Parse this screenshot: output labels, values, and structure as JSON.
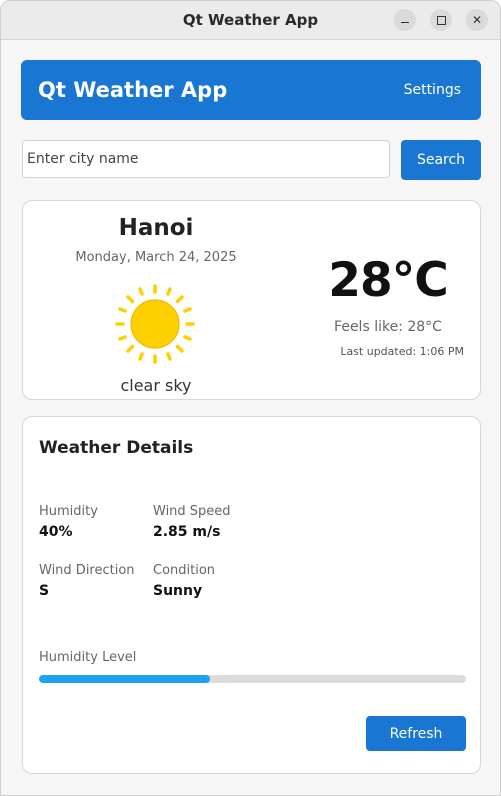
{
  "window": {
    "title": "Qt Weather App",
    "controls": {
      "minimize": "minimize-icon",
      "maximize": "maximize-icon",
      "close": "close-icon"
    }
  },
  "header": {
    "title": "Qt Weather App",
    "settings_label": "Settings"
  },
  "search": {
    "placeholder": "Enter city name",
    "value": "",
    "button_label": "Search"
  },
  "current": {
    "city": "Hanoi",
    "date": "Monday, March 24, 2025",
    "icon": "sun-icon",
    "condition_text": "clear sky",
    "temperature": "28°C",
    "feels_like": "Feels like: 28°C",
    "last_updated": "Last updated: 1:06 PM"
  },
  "details": {
    "title": "Weather Details",
    "humidity_label": "Humidity",
    "humidity_value": "40%",
    "wind_speed_label": "Wind Speed",
    "wind_speed_value": "2.85 m/s",
    "wind_direction_label": "Wind Direction",
    "wind_direction_value": "S",
    "condition_label": "Condition",
    "condition_value": "Sunny",
    "humidity_level_label": "Humidity Level",
    "humidity_level_fraction": 0.4,
    "refresh_label": "Refresh"
  },
  "colors": {
    "accent": "#1976d2",
    "progress": "#1da1f2",
    "sun": "#ffd000"
  }
}
